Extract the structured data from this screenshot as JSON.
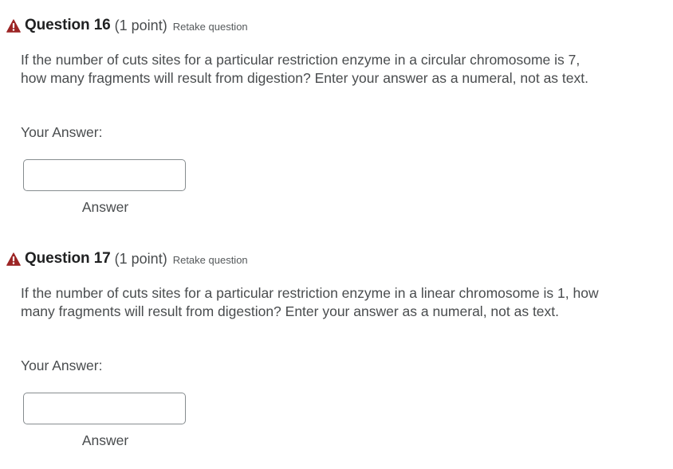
{
  "colors": {
    "warning_icon": "#9c2525",
    "title_text": "#202122",
    "body_text": "#494c4e",
    "input_border": "#868c8f"
  },
  "questions": [
    {
      "icon": "warning-triangle-icon",
      "title": "Question 16",
      "points": "(1 point)",
      "retake_label": "Retake question",
      "text": "If the number of cuts sites for a particular restriction enzyme in a circular chromosome is 7, how many fragments will result from digestion? Enter your answer as a numeral, not as text.",
      "answer_label": "Your Answer:",
      "answer_value": "",
      "answer_caption": "Answer"
    },
    {
      "icon": "warning-triangle-icon",
      "title": "Question 17",
      "points": "(1 point)",
      "retake_label": "Retake question",
      "text": "If the number of cuts sites for a particular restriction enzyme in a linear chromosome is 1, how many fragments will result from digestion? Enter your answer as a numeral, not as text.",
      "answer_label": "Your Answer:",
      "answer_value": "",
      "answer_caption": "Answer"
    }
  ]
}
